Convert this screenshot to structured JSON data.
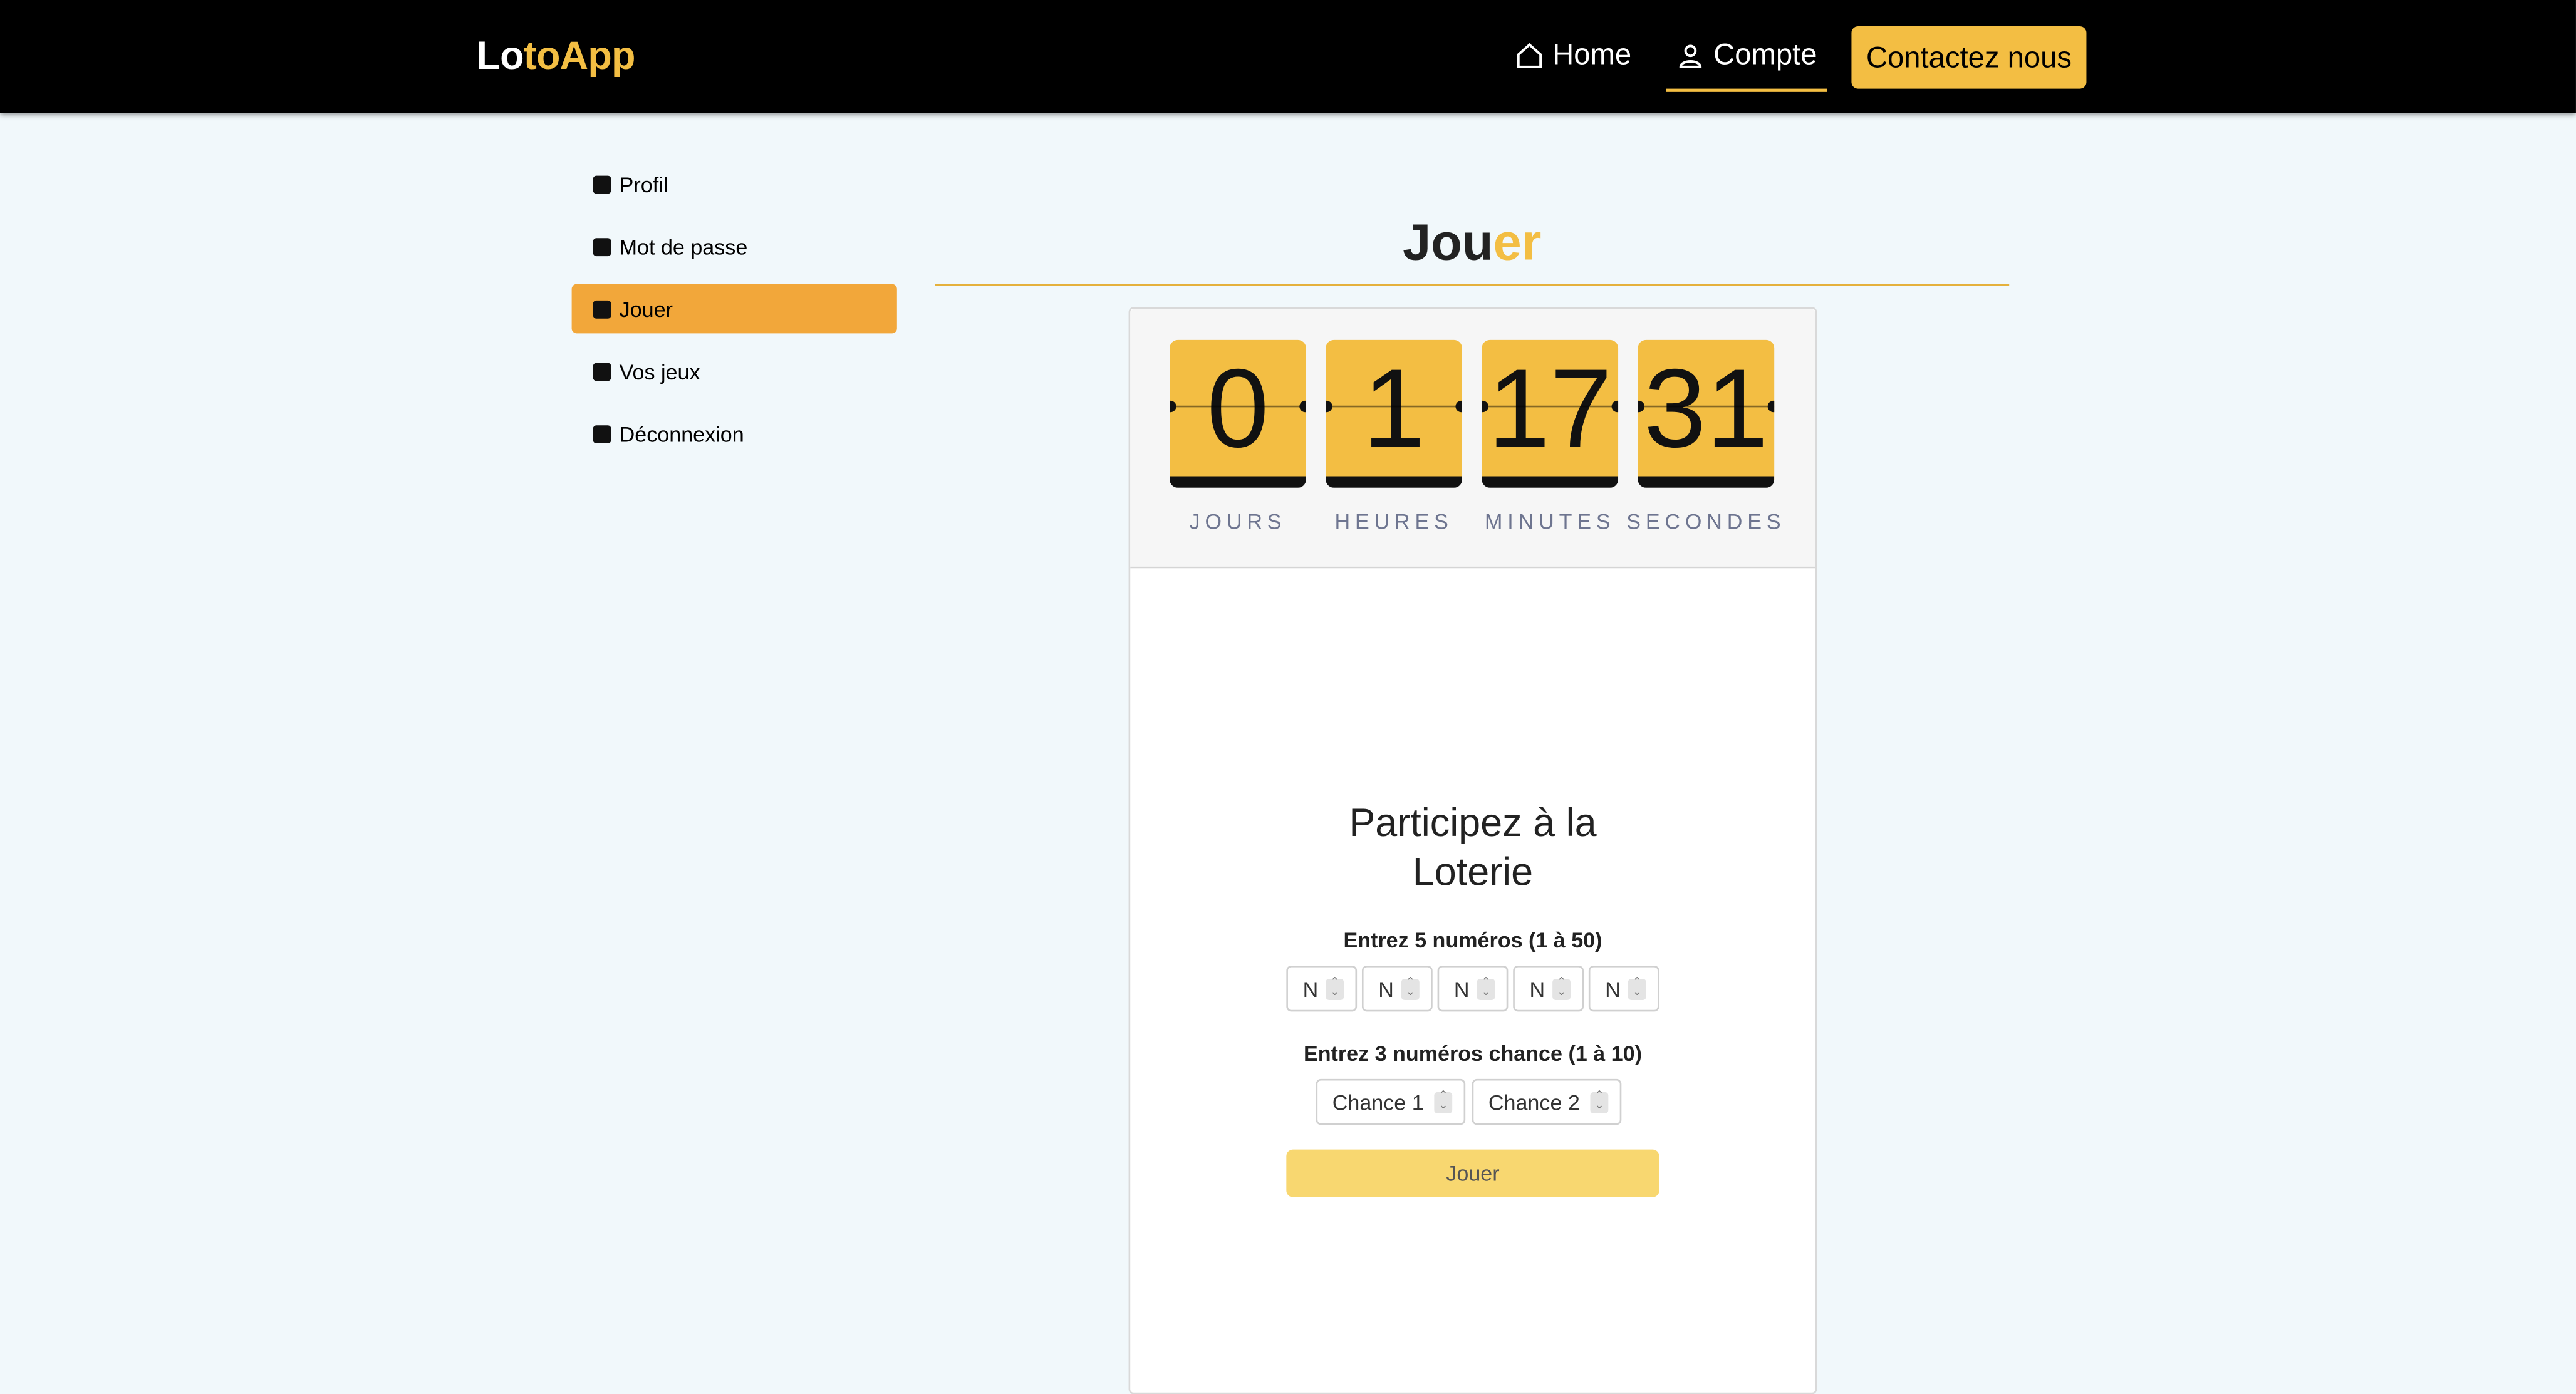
{
  "navbar": {
    "brand_part1": "Lo",
    "brand_part2": "toApp",
    "home_label": "Home",
    "compte_label": "Compte",
    "contact_label": "Contactez nous"
  },
  "sidebar": {
    "items": [
      {
        "label": "Profil",
        "icon": "info-icon"
      },
      {
        "label": "Mot de passe",
        "icon": "lock-icon"
      },
      {
        "label": "Jouer",
        "icon": "dice-icon",
        "active": true
      },
      {
        "label": "Vos jeux",
        "icon": "calendar-check-icon"
      },
      {
        "label": "Déconnexion",
        "icon": "door-icon"
      }
    ]
  },
  "page": {
    "title_part1": "Jou",
    "title_part2": "er"
  },
  "countdown": {
    "units": [
      {
        "value": "0",
        "label": "JOURS"
      },
      {
        "value": "1",
        "label": "HEURES"
      },
      {
        "value": "17",
        "label": "MINUTES"
      },
      {
        "value": "31",
        "label": "SECONDES"
      }
    ]
  },
  "form": {
    "title_line1": "Participez à la",
    "title_line2": "Loterie",
    "numbers_label": "Entrez 5 numéros (1 à 50)",
    "number_placeholder": "N",
    "chance_label": "Entrez 3 numéros chance (1 à 10)",
    "chance_placeholders": [
      "Chance 1",
      "Chance 2"
    ],
    "submit_label": "Jouer"
  },
  "colors": {
    "accent": "#f3be43",
    "active": "#f2a73a",
    "background": "#f1f8fb"
  }
}
